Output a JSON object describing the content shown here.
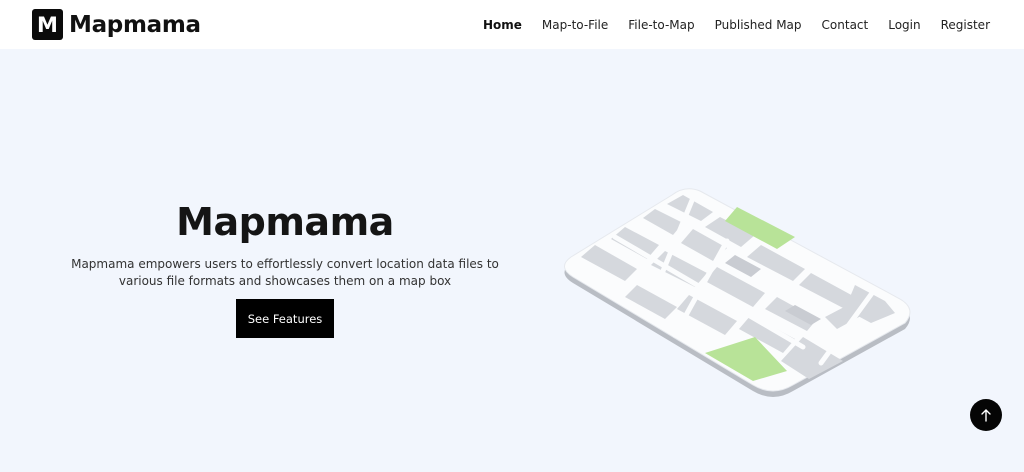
{
  "brand": {
    "logo_letter": "M",
    "name": "Mapmama"
  },
  "nav": {
    "items": [
      {
        "label": "Home",
        "active": true
      },
      {
        "label": "Map-to-File",
        "active": false
      },
      {
        "label": "File-to-Map",
        "active": false
      },
      {
        "label": "Published Map",
        "active": false
      },
      {
        "label": "Contact",
        "active": false
      },
      {
        "label": "Login",
        "active": false
      },
      {
        "label": "Register",
        "active": false
      }
    ]
  },
  "hero": {
    "title": "Mapmama",
    "description": "Mapmama empowers users to effortlessly convert location data files to various file formats and showcases them on a map box",
    "cta_label": "See Features"
  },
  "icons": {
    "scroll_top": "arrow-up-icon",
    "illustration": "isometric-map-icon"
  },
  "colors": {
    "background": "#f2f6fd",
    "navbar": "#ffffff",
    "button": "#000000",
    "map_tile": "#d3d6db",
    "map_park": "#b8e398"
  }
}
